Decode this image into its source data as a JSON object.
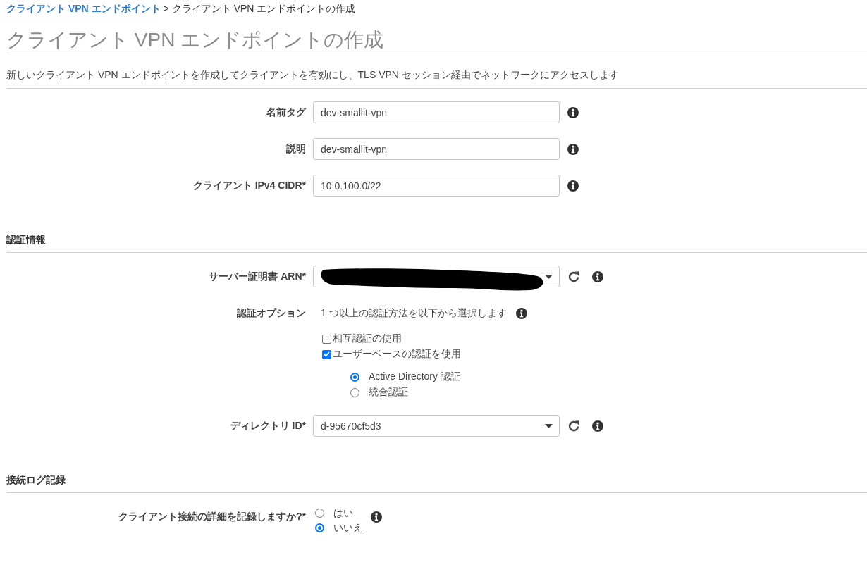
{
  "breadcrumb": {
    "items": [
      {
        "label": "クライアント VPN エンドポイント",
        "link": true
      },
      {
        "label": "クライアント VPN エンドポイントの作成",
        "link": false
      }
    ],
    "separator": ">"
  },
  "header": {
    "title": "クライアント VPN エンドポイントの作成",
    "description": "新しいクライアント VPN エンドポイントを作成してクライアントを有効にし、TLS VPN セッション経由でネットワークにアクセスします"
  },
  "sections": [
    {
      "rows": [
        {
          "kind": "text",
          "label": "名前タグ",
          "value": "dev-smallit-vpn"
        },
        {
          "kind": "text",
          "label": "説明",
          "value": "dev-smallit-vpn"
        },
        {
          "kind": "text",
          "label": "クライアント IPv4 CIDR*",
          "value": "10.0.100.0/22"
        }
      ]
    },
    {
      "heading": "認証情報",
      "rows": [
        {
          "kind": "select",
          "label": "サーバー証明書 ARN*",
          "redacted": true
        },
        {
          "kind": "options",
          "label": "認証オプション",
          "hint": "1 つ以上の認証方法を以下から選択します",
          "checkboxes": [
            {
              "label": "相互認証の使用",
              "checked": false
            },
            {
              "label": "ユーザーベースの認証を使用",
              "checked": true,
              "choices": [
                {
                  "label": "Active Directory 認証",
                  "selected": true
                },
                {
                  "label": "統合認証",
                  "selected": false
                }
              ]
            }
          ]
        },
        {
          "kind": "select",
          "label": "ディレクトリ ID*",
          "value": "d-95670cf5d3"
        }
      ]
    },
    {
      "heading": "接続ログ記録",
      "rows": [
        {
          "kind": "radio",
          "label": "クライアント接続の詳細を記録しますか?*",
          "choices": [
            {
              "label": "はい",
              "selected": false
            },
            {
              "label": "いいえ",
              "selected": true
            }
          ]
        }
      ]
    }
  ]
}
